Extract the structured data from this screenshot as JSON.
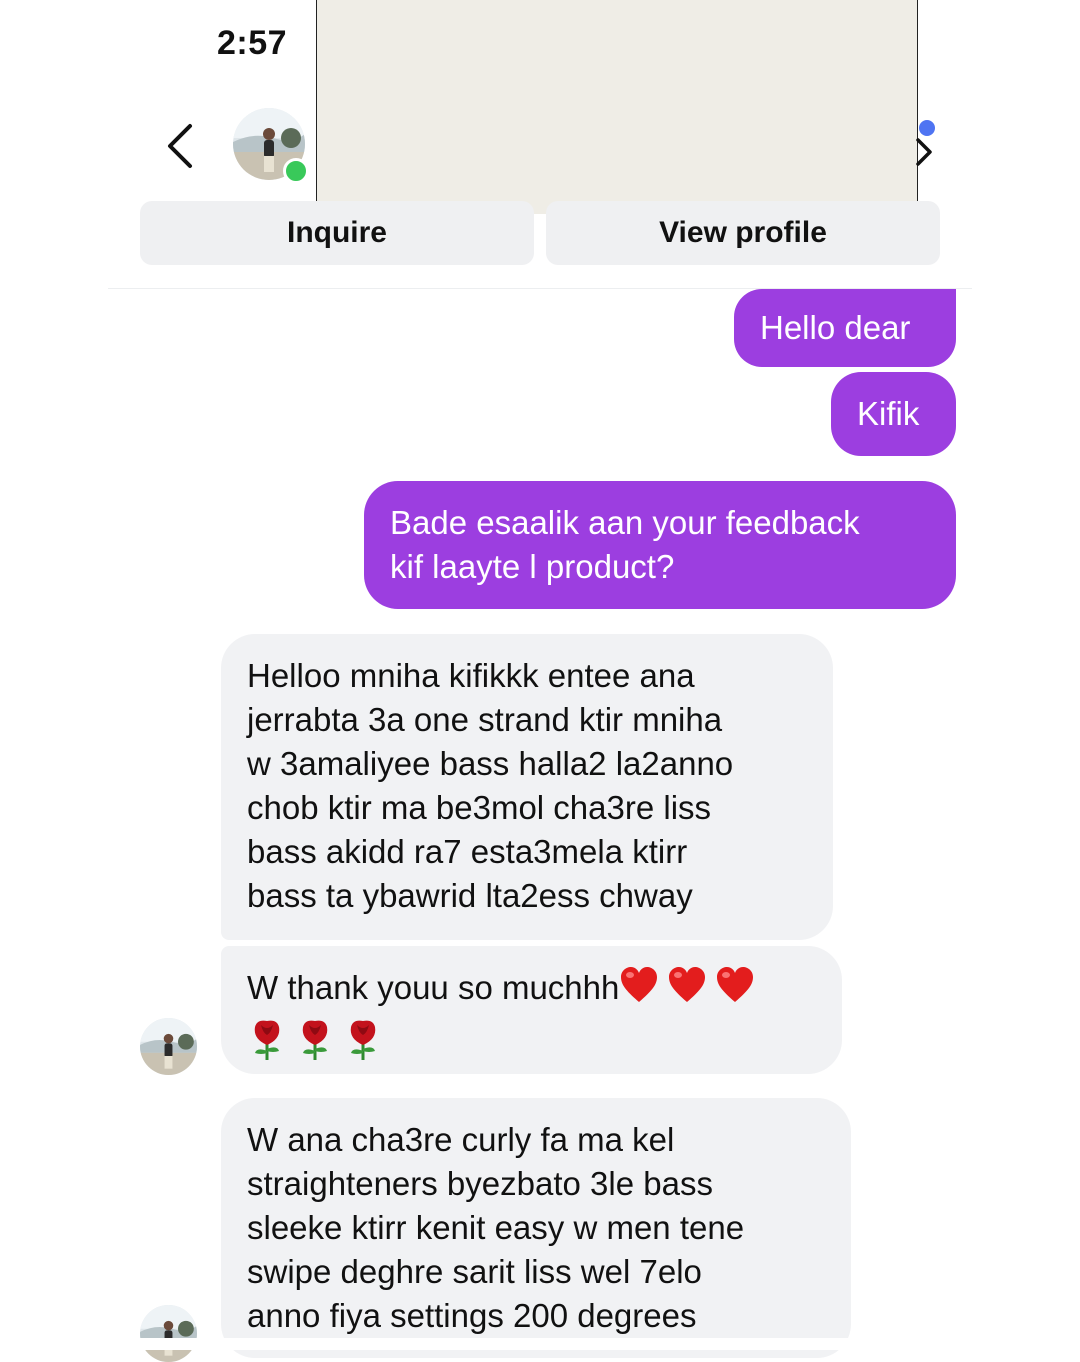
{
  "status_bar": {
    "time": "2:57"
  },
  "header": {
    "back_icon": "chevron-left-icon",
    "next_icon": "chevron-right-icon",
    "online_color": "#39c95a",
    "unread_dot_color": "#4f74f2"
  },
  "actions": {
    "inquire_label": "Inquire",
    "view_profile_label": "View profile"
  },
  "colors": {
    "outgoing_bubble": "#9c3ee0",
    "incoming_bubble": "#f1f2f4"
  },
  "messages": [
    {
      "direction": "outgoing",
      "lines": [
        "Hello dear"
      ]
    },
    {
      "direction": "outgoing",
      "lines": [
        "Kifik"
      ]
    },
    {
      "direction": "outgoing",
      "lines": [
        "Bade esaalik aan your feedback",
        "kif laayte l product?"
      ]
    },
    {
      "direction": "incoming",
      "lines": [
        "Helloo mniha kifikkk entee ana",
        "jerrabta 3a one strand ktir mniha",
        "w 3amaliyee bass halla2 la2anno",
        "chob ktir ma be3mol cha3re liss",
        "bass akidd ra7 esta3mela ktirr",
        "bass ta ybawrid lta2ess chway"
      ]
    },
    {
      "direction": "incoming",
      "lines": [
        "W thank youu so muchhh"
      ],
      "emoji": [
        "heart-icon",
        "heart-icon",
        "heart-icon",
        "rose-icon",
        "rose-icon",
        "rose-icon"
      ]
    },
    {
      "direction": "incoming",
      "lines": [
        "W ana cha3re curly fa ma kel",
        "straighteners byezbato 3le bass",
        "sleeke ktirr kenit easy w men tene",
        "swipe deghre sarit liss wel 7elo",
        "anno fiya settings 200 degrees"
      ]
    }
  ]
}
